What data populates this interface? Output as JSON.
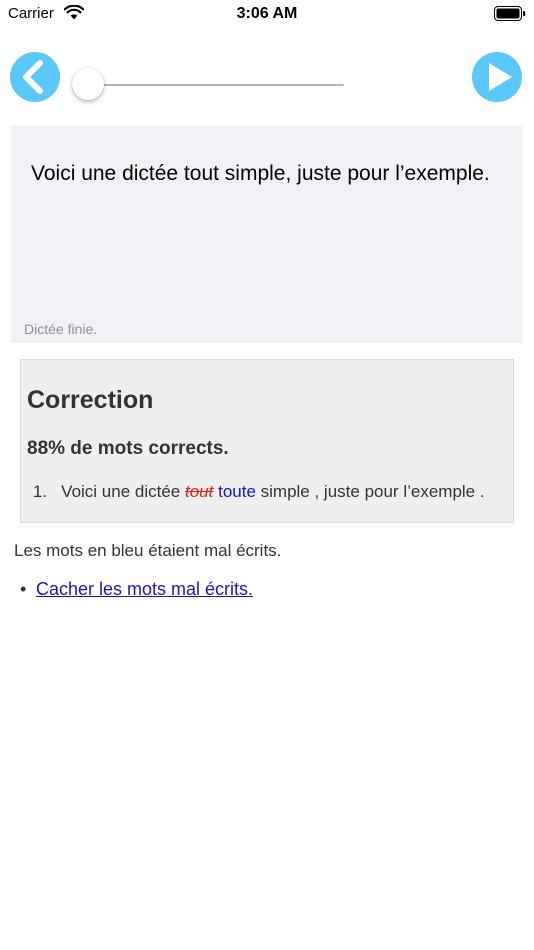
{
  "status_bar": {
    "carrier": "Carrier",
    "time": "3:06 AM"
  },
  "toolbar": {
    "back_icon": "chevron-left-circle",
    "play_icon": "play-circle",
    "accent_color": "#5ac8fa",
    "playback_progress": 0.0
  },
  "dictation": {
    "text": "Voici une dictée tout simple, juste pour l’exemple.",
    "status": "Dictée finie."
  },
  "correction": {
    "title": "Correction",
    "score": "88% de mots corrects.",
    "line_number": "1.",
    "segment_before": "Voici une dictée",
    "wrong_word": "tout",
    "fixed_word": "toute",
    "segment_after": "simple , juste pour l’exemple .",
    "wrong_color": "#e0231b",
    "fixed_color": "#1a12c8"
  },
  "note": "Les mots en bleu étaient mal écrits.",
  "hide_link": "Cacher les mots mal écrits."
}
